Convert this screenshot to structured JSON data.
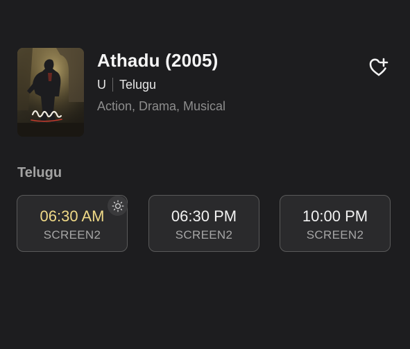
{
  "movie": {
    "title": "Athadu (2005)",
    "certificate": "U",
    "language": "Telugu",
    "genres": "Action, Drama, Musical",
    "poster_icon": "movie-poster-image",
    "favorite_icon": "heart-plus-icon"
  },
  "showtimes_section": {
    "heading": "Telugu",
    "slots": [
      {
        "time": "06:30 AM",
        "screen": "SCREEN2",
        "icon": "sun-icon"
      },
      {
        "time": "06:30 PM",
        "screen": "SCREEN2"
      },
      {
        "time": "10:00 PM",
        "screen": "SCREEN2"
      }
    ]
  },
  "colors": {
    "background": "#1d1d1f",
    "card": "#2a2a2c",
    "card_border": "#5a5a5a",
    "morning_highlight": "#efd987",
    "muted_text": "#8d8d8d"
  }
}
